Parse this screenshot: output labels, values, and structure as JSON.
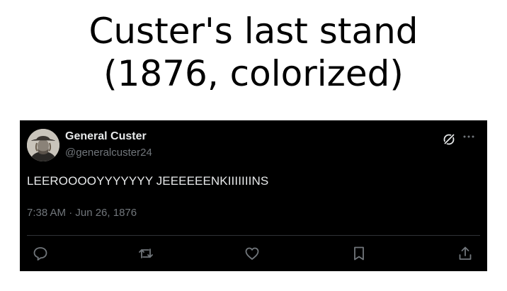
{
  "caption": {
    "line1": "Custer's last stand",
    "line2": "(1876, colorized)"
  },
  "tweet": {
    "display_name": "General Custer",
    "handle": "@generalcuster24",
    "text": "LEEROOOOYYYYYYY JEEEEEENKIIIIIIINS",
    "timestamp": "7:38 AM · Jun 26, 1876",
    "header_icons": [
      "grok-icon",
      "more-icon"
    ],
    "actions": [
      "reply-icon",
      "retweet-icon",
      "like-icon",
      "bookmark-icon",
      "share-icon"
    ],
    "colors": {
      "background": "#000000",
      "primary_text": "#e7e9ea",
      "secondary_text": "#71767b"
    }
  }
}
